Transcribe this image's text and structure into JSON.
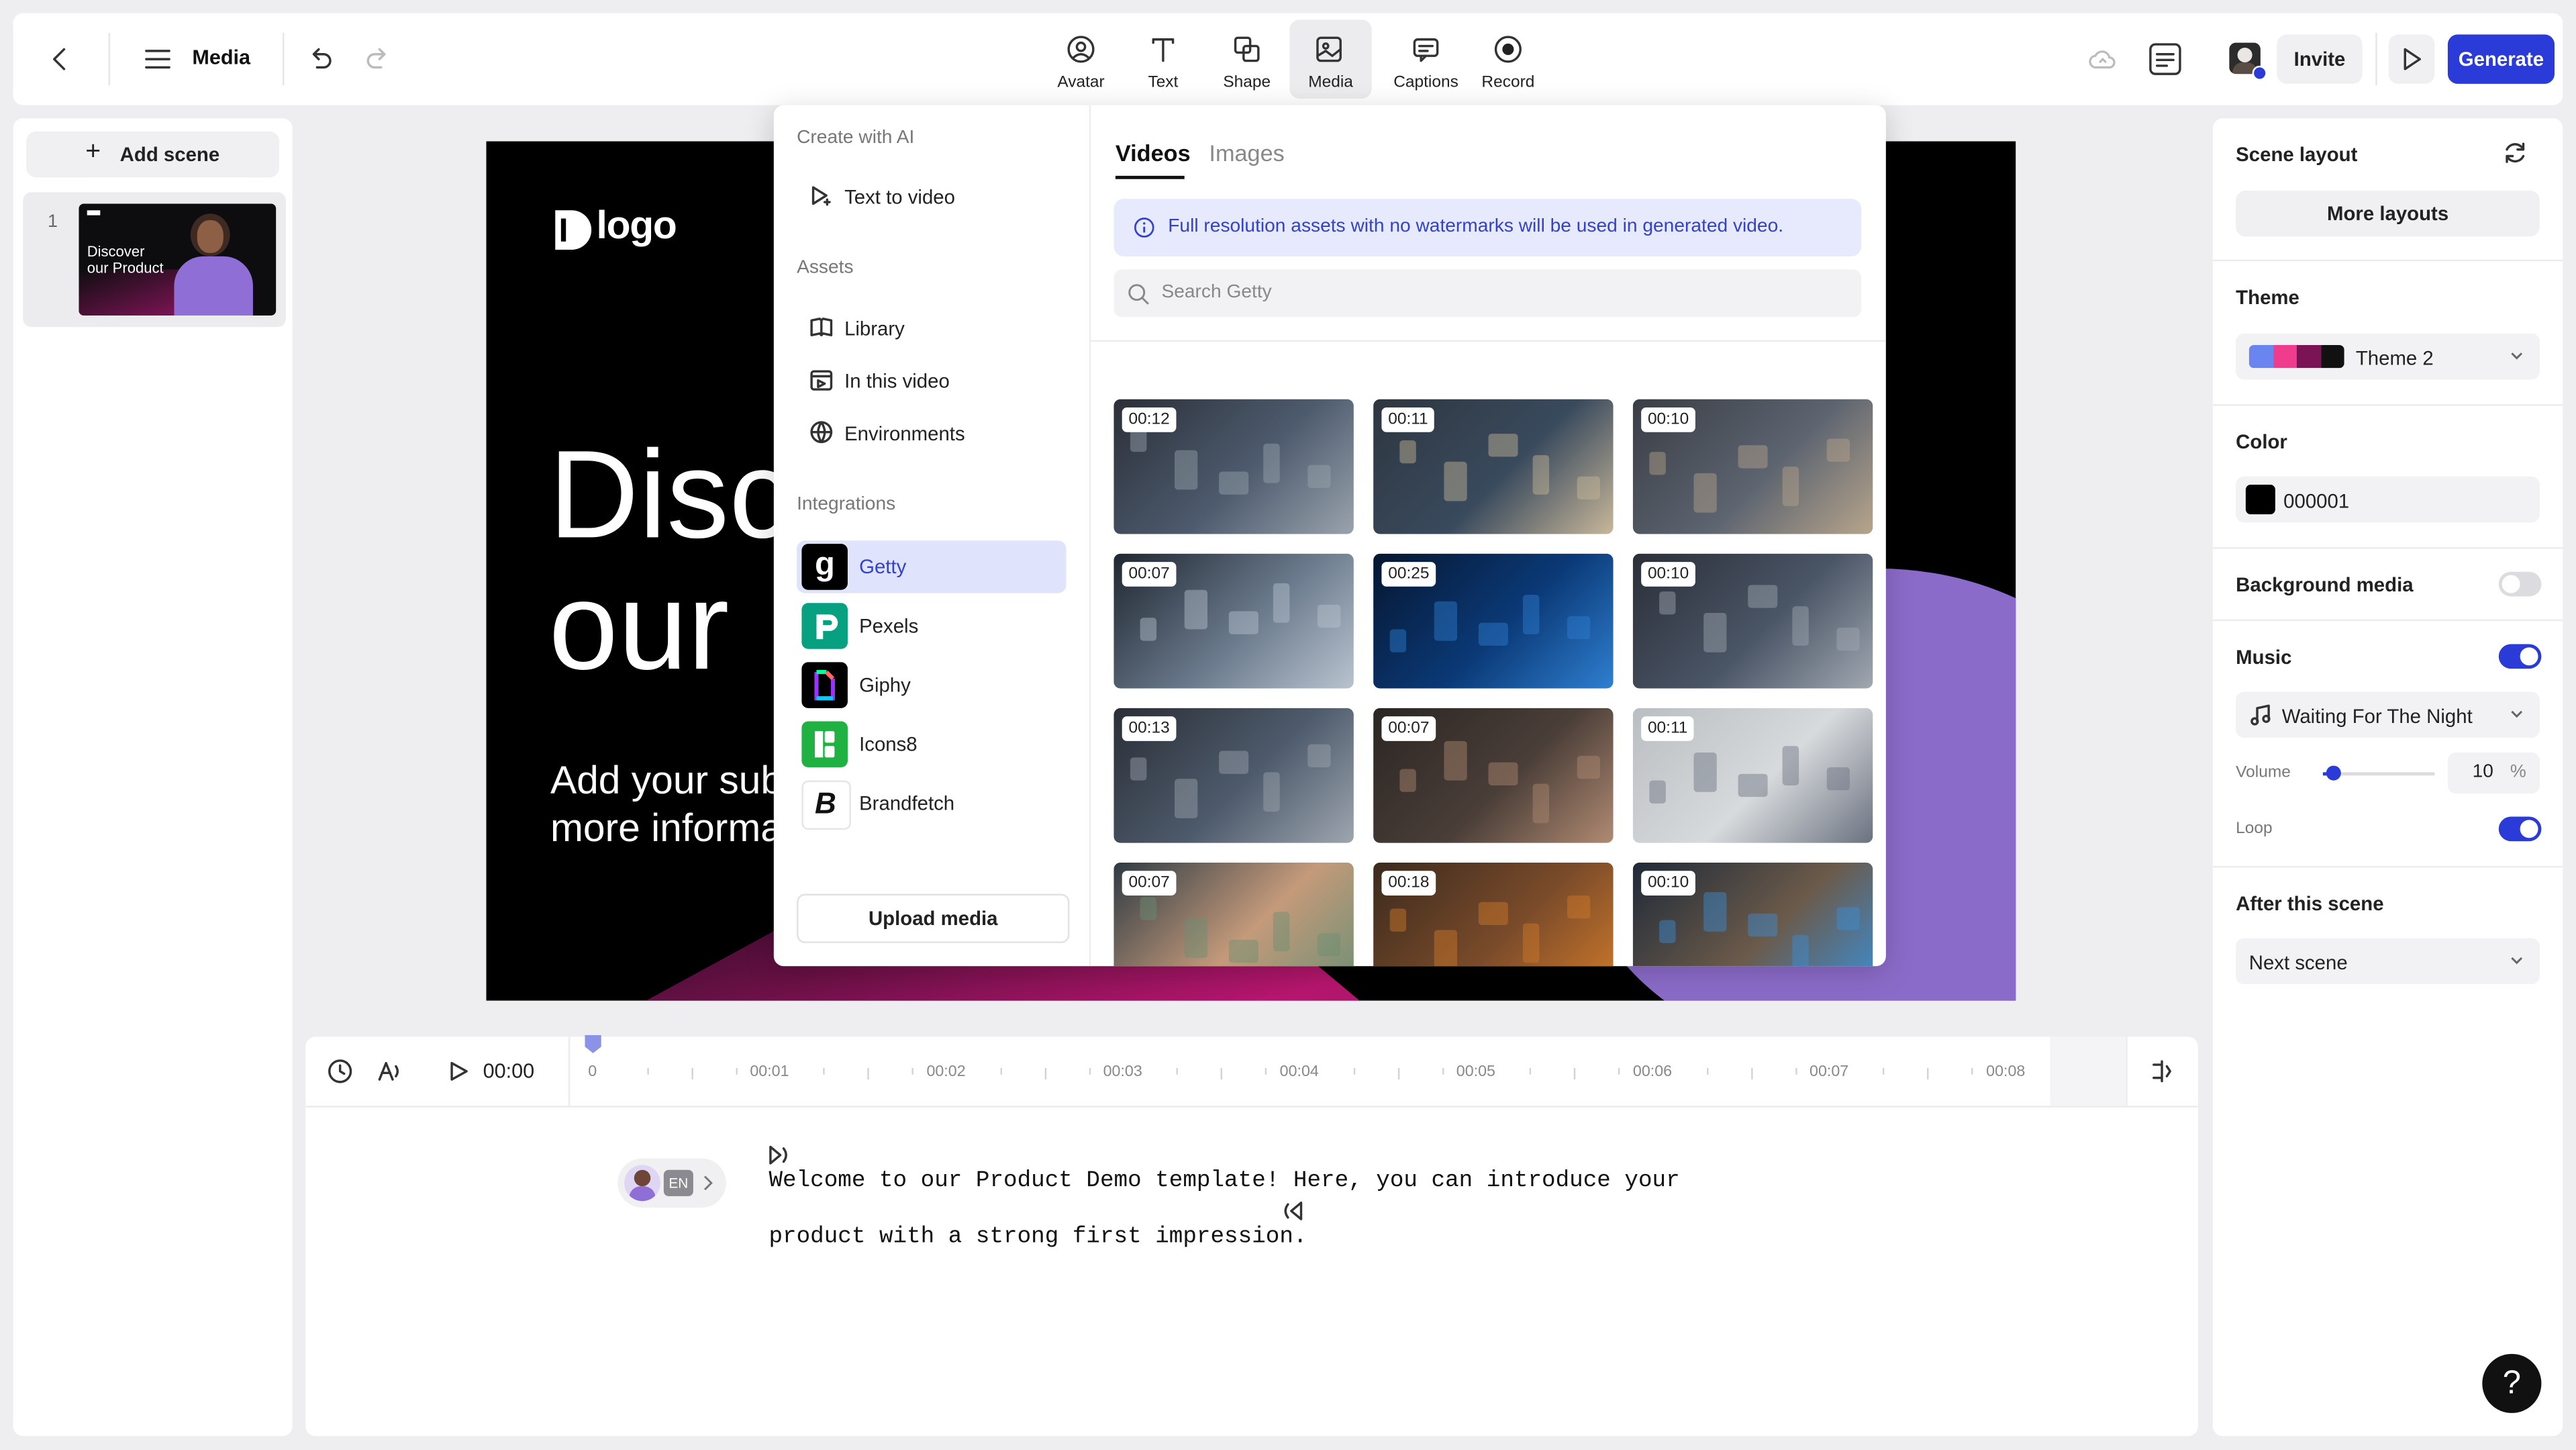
{
  "topbar": {
    "section_title": "Media",
    "tools": [
      {
        "label": "Avatar",
        "icon": "avatar-icon"
      },
      {
        "label": "Text",
        "icon": "text-icon"
      },
      {
        "label": "Shape",
        "icon": "shape-icon"
      },
      {
        "label": "Media",
        "icon": "media-icon",
        "active": true
      },
      {
        "label": "Captions",
        "icon": "captions-icon"
      },
      {
        "label": "Record",
        "icon": "record-icon"
      }
    ],
    "invite_label": "Invite",
    "generate_label": "Generate"
  },
  "scenes": {
    "add_label": "Add scene",
    "items": [
      {
        "number": "1",
        "thumb_title_line1": "Discover",
        "thumb_title_line2": "our Product"
      }
    ]
  },
  "canvas": {
    "logo_text": "logo",
    "title_line1": "Disc",
    "title_line2": "our",
    "subtitle_line1": "Add your sub",
    "subtitle_line2": "more informa"
  },
  "media_panel": {
    "create_head": "Create with AI",
    "text_to_video": "Text to video",
    "assets_head": "Assets",
    "assets": [
      "Library",
      "In this video",
      "Environments"
    ],
    "integrations_head": "Integrations",
    "integrations": [
      "Getty",
      "Pexels",
      "Giphy",
      "Icons8",
      "Brandfetch"
    ],
    "selected_integration": "Getty",
    "upload_label": "Upload media",
    "tabs": [
      "Videos",
      "Images"
    ],
    "active_tab": "Videos",
    "notice": "Full resolution assets with no watermarks will be used in generated video.",
    "search_placeholder": "Search Getty",
    "durations": [
      "00:12",
      "00:11",
      "00:10",
      "00:07",
      "00:25",
      "00:10",
      "00:13",
      "00:07",
      "00:11",
      "00:07",
      "00:18",
      "00:10"
    ]
  },
  "timeline": {
    "time": "00:00",
    "ticks": [
      "0",
      "00:01",
      "00:02",
      "00:03",
      "00:04",
      "00:05",
      "00:06",
      "00:07",
      "00:08"
    ]
  },
  "script": {
    "language": "EN",
    "line1": "Welcome to our Product Demo template! Here, you can introduce your",
    "line2": "product with a strong first impression."
  },
  "right_panel": {
    "scene_layout": "Scene layout",
    "more_layouts": "More layouts",
    "theme_head": "Theme",
    "theme_value": "Theme 2",
    "theme_swatches": [
      "#6a84f0",
      "#f03c8c",
      "#7a1454",
      "#111111"
    ],
    "color_head": "Color",
    "color_value": "000001",
    "background_media": "Background media",
    "background_media_on": false,
    "music_head": "Music",
    "music_on": true,
    "music_track": "Waiting For The Night",
    "volume_label": "Volume",
    "volume_value": "10",
    "volume_unit": "%",
    "loop_label": "Loop",
    "loop_on": true,
    "after_scene_head": "After this scene",
    "after_scene_value": "Next scene"
  },
  "help_label": "?",
  "colors": {
    "accent": "#2b3bd8",
    "selected_bg": "#dfe3fb",
    "notice_bg": "#e6eafc"
  }
}
